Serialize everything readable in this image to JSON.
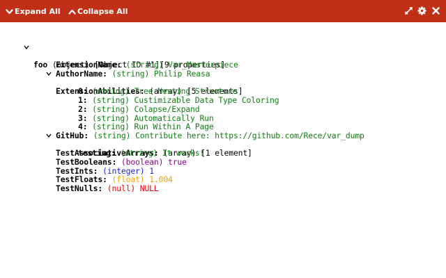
{
  "toolbar": {
    "expand_all_label": "Expand All",
    "collapse_all_label": "Collapse All",
    "background": "#bf3017",
    "icons": [
      "chevron-down-icon",
      "expand-arrows-icon",
      "gear-icon",
      "close-icon"
    ]
  },
  "colors": {
    "string": "#0f7f12",
    "boolean": "#92008d",
    "integer": "#1f24d2",
    "float": "#f0a30a",
    "null": "#ee0000"
  },
  "tree": {
    "root": {
      "key": "foo",
      "type": "(object)",
      "info": "[Object ID #1][9 properties]"
    },
    "extension_name": {
      "key": "ExtensionName:",
      "type": "(string)",
      "value": "Var_Masterpiece"
    },
    "author_name": {
      "key": "AuthorName:",
      "type": "(string)",
      "value": "Philip Reasa"
    },
    "extension_abilities": {
      "key": "ExtensionAbilities:",
      "type": "(array)",
      "info": "[5 elements]",
      "items": [
        {
          "key": "0:",
          "type": "(string)",
          "value": "Tree Nesting Structure"
        },
        {
          "key": "1:",
          "type": "(string)",
          "value": "Custimizable Data Type Coloring"
        },
        {
          "key": "2:",
          "type": "(string)",
          "value": "Colapse/Expand"
        },
        {
          "key": "3:",
          "type": "(string)",
          "value": "Automatically Run"
        },
        {
          "key": "4:",
          "type": "(string)",
          "value": "Run Within A Page"
        }
      ]
    },
    "github": {
      "key": "GitHub:",
      "type": "(string)",
      "value": "Contribute here: https://github.com/Rece/var_dump"
    },
    "test_assoc": {
      "key": "TestAssociativeArrays:",
      "type": "(array)",
      "info": "[1 element]",
      "items": [
        {
          "key": "testing:",
          "type": "(string)",
          "value": "It works!"
        }
      ]
    },
    "test_booleans": {
      "key": "TestBooleans:",
      "type": "(boolean)",
      "value": "true"
    },
    "test_ints": {
      "key": "TestInts:",
      "type": "(integer)",
      "value": "1"
    },
    "test_floats": {
      "key": "TestFloats:",
      "type": "(float)",
      "value": "1.004"
    },
    "test_nulls": {
      "key": "TestNulls:",
      "type": "(null)",
      "value": "NULL"
    }
  }
}
